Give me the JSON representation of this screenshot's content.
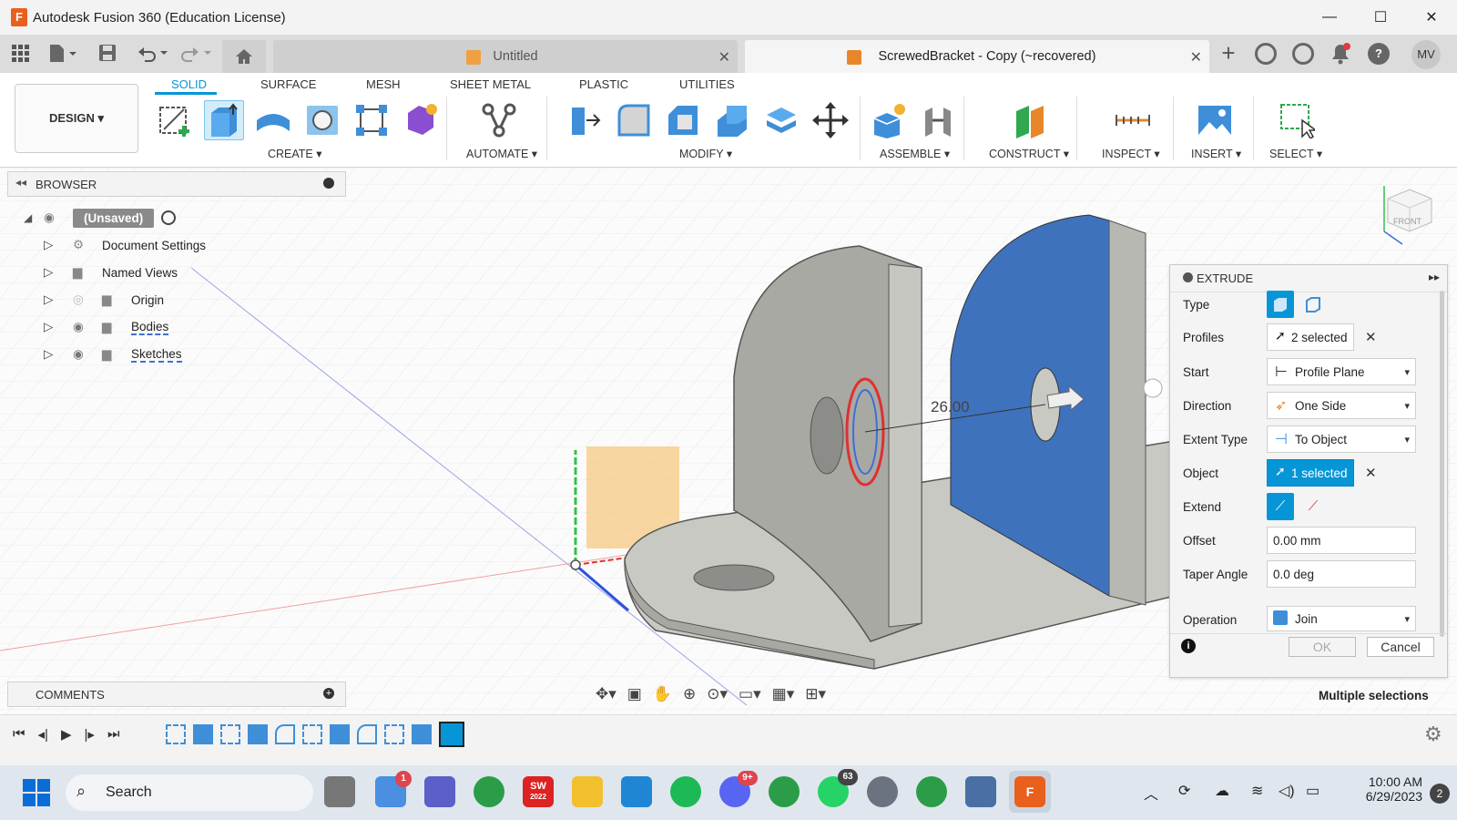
{
  "titlebar": {
    "title": "Autodesk Fusion 360 (Education License)",
    "minimize": "—",
    "maximize": "☐",
    "close": "✕"
  },
  "doc_tabs": [
    {
      "label": "Untitled",
      "active": false
    },
    {
      "label": "ScrewedBracket - Copy (~recovered)",
      "active": true
    }
  ],
  "account": {
    "initials": "MV"
  },
  "workspace": {
    "label": "DESIGN ▾"
  },
  "ribbon": {
    "tabs": [
      "SOLID",
      "SURFACE",
      "MESH",
      "SHEET METAL",
      "PLASTIC",
      "UTILITIES"
    ],
    "active_tab": "SOLID",
    "groups": [
      "CREATE ▾",
      "AUTOMATE ▾",
      "MODIFY ▾",
      "ASSEMBLE ▾",
      "CONSTRUCT ▾",
      "INSPECT ▾",
      "INSERT ▾",
      "SELECT ▾"
    ]
  },
  "browser": {
    "title": "BROWSER",
    "root": "(Unsaved)",
    "items": [
      "Document Settings",
      "Named Views",
      "Origin",
      "Bodies",
      "Sketches"
    ]
  },
  "comments": {
    "title": "COMMENTS"
  },
  "viewport": {
    "dimension": "26.00",
    "viewcube": "FRONT",
    "status": "Multiple selections"
  },
  "extrude": {
    "title": "EXTRUDE",
    "rows": {
      "type": "Type",
      "profiles": "Profiles",
      "start": "Start",
      "direction": "Direction",
      "extent_type": "Extent Type",
      "object": "Object",
      "extend": "Extend",
      "offset": "Offset",
      "taper": "Taper Angle",
      "operation": "Operation"
    },
    "values": {
      "profiles": "2 selected",
      "start": "Profile Plane",
      "direction": "One Side",
      "extent_type": "To Object",
      "object": "1 selected",
      "offset": "0.00 mm",
      "taper": "0.0 deg",
      "operation": "Join"
    },
    "ok": "OK",
    "cancel": "Cancel"
  },
  "taskbar": {
    "search": "Search",
    "time": "10:00 AM",
    "date": "6/29/2023",
    "notifications": "2",
    "badges": {
      "onedrive": "1",
      "discord": "9+",
      "whatsapp": "63"
    },
    "sw_label": "SW",
    "sw_year": "2022"
  },
  "colors": {
    "accent": "#0696d7",
    "blue_face": "#3f72bd",
    "body_gray": "#a9a9a4"
  }
}
